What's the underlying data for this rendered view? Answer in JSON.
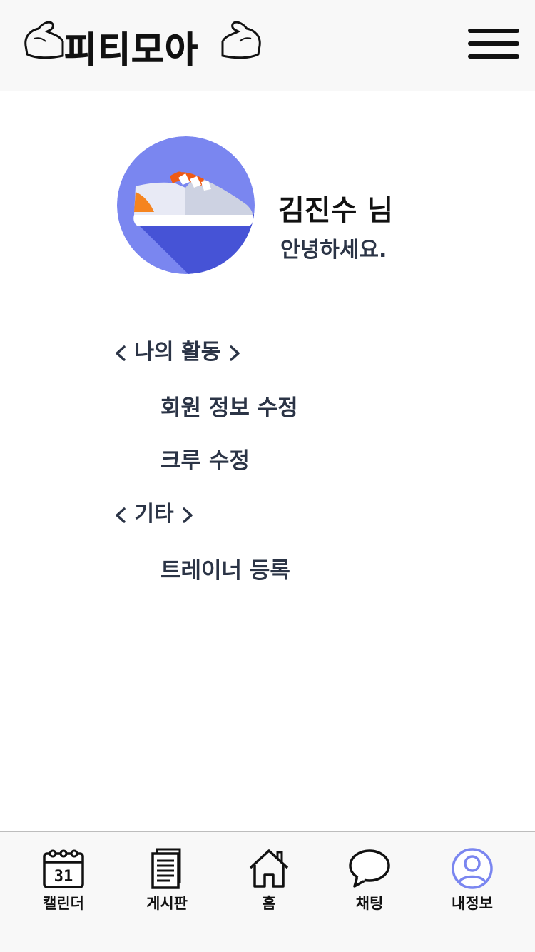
{
  "header": {
    "logo_text": "피티모아",
    "menu_icon": "hamburger-menu-icon"
  },
  "profile": {
    "avatar_icon": "sneaker-icon",
    "name": "김진수 님",
    "greeting": "안녕하세요."
  },
  "sections": [
    {
      "title": "나의 활동",
      "items": [
        "회원 정보 수정",
        "크루 수정"
      ]
    },
    {
      "title": "기타",
      "items": [
        "트레이너 등록"
      ]
    }
  ],
  "nav": {
    "items": [
      {
        "label": "캘린더",
        "icon": "calendar-icon"
      },
      {
        "label": "게시판",
        "icon": "document-icon"
      },
      {
        "label": "홈",
        "icon": "home-icon"
      },
      {
        "label": "채팅",
        "icon": "chat-bubble-icon"
      },
      {
        "label": "내정보",
        "icon": "user-profile-icon"
      }
    ],
    "active_color": "#7a86f0",
    "calendar_day": "31"
  },
  "colors": {
    "avatar_bg": "#7a86f0",
    "avatar_shadow": "#4653d6",
    "shoe_accent": "#f05a14"
  }
}
